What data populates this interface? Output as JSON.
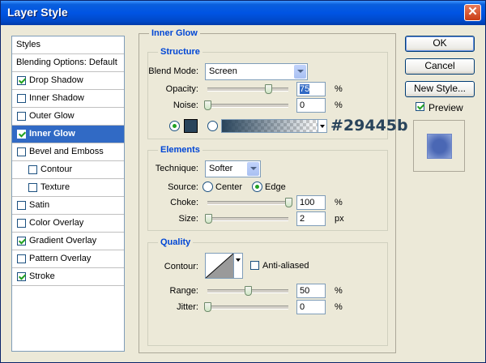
{
  "window": {
    "title": "Layer Style",
    "close": "✕"
  },
  "styles": [
    {
      "label": "Styles",
      "checkbox": false
    },
    {
      "label": "Blending Options: Default",
      "checkbox": false
    },
    {
      "label": "Drop Shadow",
      "checkbox": true,
      "checked": true
    },
    {
      "label": "Inner Shadow",
      "checkbox": true,
      "checked": false
    },
    {
      "label": "Outer Glow",
      "checkbox": true,
      "checked": false
    },
    {
      "label": "Inner Glow",
      "checkbox": true,
      "checked": true,
      "selected": true
    },
    {
      "label": "Bevel and Emboss",
      "checkbox": true,
      "checked": false
    },
    {
      "label": "Contour",
      "checkbox": true,
      "checked": false,
      "indent": true
    },
    {
      "label": "Texture",
      "checkbox": true,
      "checked": false,
      "indent": true
    },
    {
      "label": "Satin",
      "checkbox": true,
      "checked": false
    },
    {
      "label": "Color Overlay",
      "checkbox": true,
      "checked": false
    },
    {
      "label": "Gradient Overlay",
      "checkbox": true,
      "checked": true
    },
    {
      "label": "Pattern Overlay",
      "checkbox": true,
      "checked": false
    },
    {
      "label": "Stroke",
      "checkbox": true,
      "checked": true
    }
  ],
  "panel": {
    "title": "Inner Glow"
  },
  "structure": {
    "title": "Structure",
    "blend_mode_label": "Blend Mode:",
    "blend_mode_value": "Screen",
    "opacity_label": "Opacity:",
    "opacity_value": "75",
    "opacity_fraction": 0.75,
    "noise_label": "Noise:",
    "noise_value": "0",
    "noise_fraction": 0,
    "unit": "%",
    "color_hex": "#29445b",
    "swatch_color": "#29445b"
  },
  "elements": {
    "title": "Elements",
    "technique_label": "Technique:",
    "technique_value": "Softer",
    "source_label": "Source:",
    "source_center": "Center",
    "source_edge": "Edge",
    "choke_label": "Choke:",
    "choke_value": "100",
    "choke_fraction": 1.0,
    "size_label": "Size:",
    "size_value": "2",
    "size_fraction": 0.01,
    "percent": "%",
    "px": "px"
  },
  "quality": {
    "title": "Quality",
    "contour_label": "Contour:",
    "anti_aliased_label": "Anti-aliased",
    "range_label": "Range:",
    "range_value": "50",
    "range_fraction": 0.5,
    "jitter_label": "Jitter:",
    "jitter_value": "0",
    "jitter_fraction": 0,
    "unit": "%"
  },
  "buttons": {
    "ok": "OK",
    "cancel": "Cancel",
    "new_style": "New Style...",
    "preview": "Preview",
    "preview_checked": true
  }
}
